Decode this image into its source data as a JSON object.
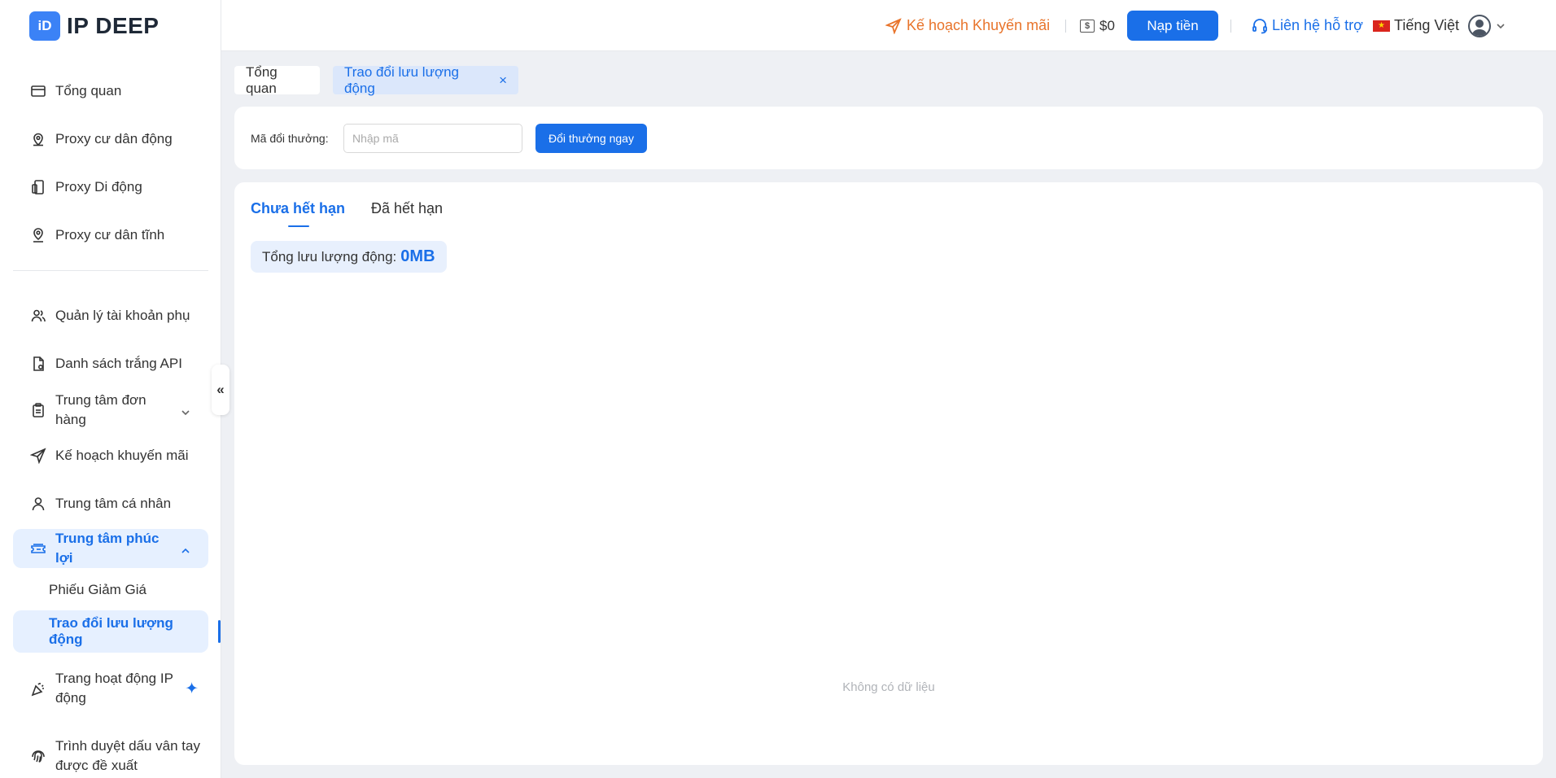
{
  "brand": {
    "logo_mark": "iD",
    "name": "IP DEEP"
  },
  "sidebar": {
    "items": [
      {
        "label": "Tổng quan",
        "icon": "card-icon"
      },
      {
        "label": "Proxy cư dân động",
        "icon": "location-pin-icon"
      },
      {
        "label": "Proxy Di động",
        "icon": "mobile-icon"
      },
      {
        "label": "Proxy cư dân tĩnh",
        "icon": "location-icon"
      },
      {
        "label": "Quản lý tài khoản phụ",
        "icon": "users-icon"
      },
      {
        "label": "Danh sách trắng API",
        "icon": "file-icon"
      },
      {
        "label": "Trung tâm đơn hàng",
        "icon": "clipboard-icon"
      },
      {
        "label": "Kế hoạch khuyến mãi",
        "icon": "send-icon"
      },
      {
        "label": "Trung tâm cá nhân",
        "icon": "user-icon"
      },
      {
        "label": "Trung tâm phúc lợi",
        "icon": "ticket-icon"
      },
      {
        "label": "Trang hoạt động IP động",
        "icon": "party-icon"
      },
      {
        "label": "Trình duyệt dấu vân tay được đề xuất",
        "icon": "fingerprint-icon"
      }
    ],
    "submenu": [
      {
        "label": "Phiếu Giảm Giá"
      },
      {
        "label": "Trao đổi lưu lượng động"
      }
    ],
    "collapse_label": "«",
    "sparkle": "✦"
  },
  "header": {
    "promo": "Kế hoạch Khuyến mãi",
    "balance_icon": "$",
    "balance": "$0",
    "topup": "Nạp tiền",
    "support": "Liên hệ hỗ trợ",
    "flag_star": "★",
    "language": "Tiếng Việt"
  },
  "tabs": [
    {
      "label": "Tổng quan"
    },
    {
      "label": "Trao đổi lưu lượng động",
      "close": "×"
    }
  ],
  "redeem": {
    "label": "Mã đổi thưởng:",
    "placeholder": "Nhập mã",
    "button": "Đổi thưởng ngay"
  },
  "main": {
    "tabs": [
      {
        "label": "Chưa hết hạn"
      },
      {
        "label": "Đã hết hạn"
      }
    ],
    "total_label": "Tổng lưu lượng động:",
    "total_value": "0MB",
    "empty": "Không có dữ liệu"
  },
  "colors": {
    "accent": "#1a6fe8",
    "promo": "#e8742b",
    "background": "#eef0f4"
  }
}
